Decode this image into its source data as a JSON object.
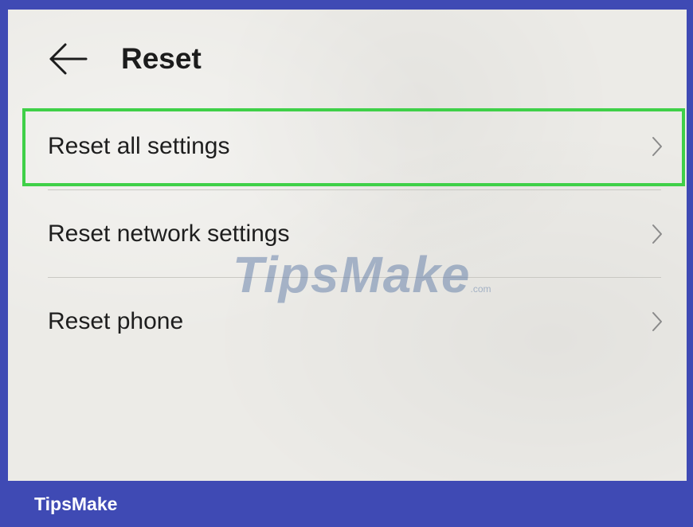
{
  "header": {
    "title": "Reset",
    "back_icon": "arrow-left-icon"
  },
  "menu": {
    "items": [
      {
        "label": "Reset all settings",
        "icon": "chevron-right-icon",
        "highlighted": true
      },
      {
        "label": "Reset network settings",
        "icon": "chevron-right-icon",
        "highlighted": false
      },
      {
        "label": "Reset phone",
        "icon": "chevron-right-icon",
        "highlighted": false
      }
    ]
  },
  "watermark": {
    "text": "TipsMake",
    "suffix": ".com"
  },
  "footer": {
    "brand": "TipsMake"
  },
  "colors": {
    "frame": "#3f4ab4",
    "screen": "#ecebe7",
    "highlight": "#3fd048",
    "text": "#1e1e1e"
  }
}
